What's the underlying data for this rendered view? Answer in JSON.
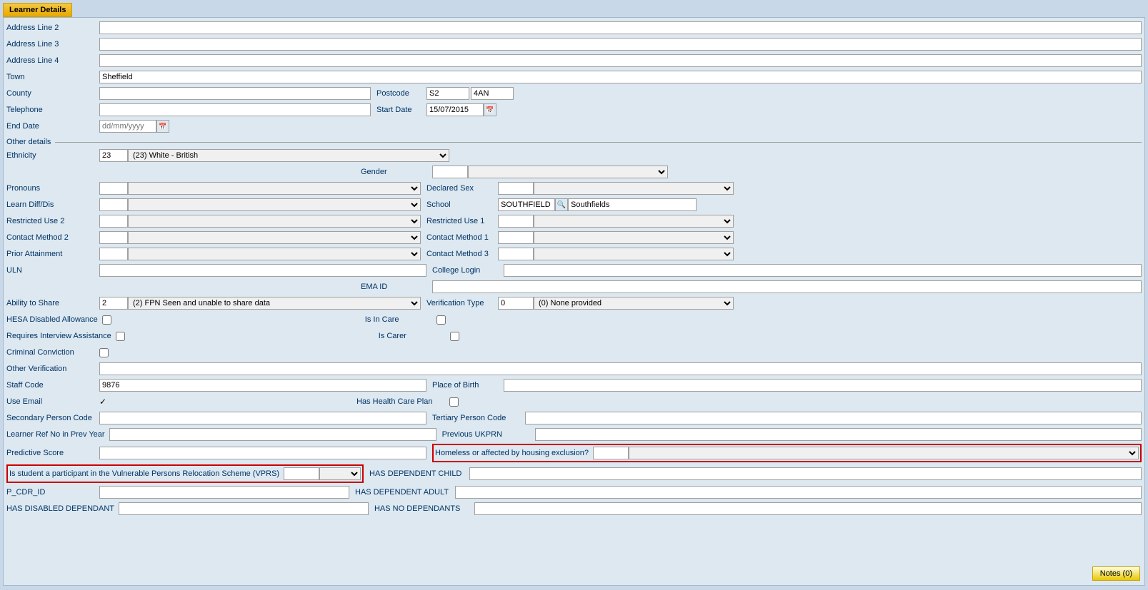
{
  "title": "Learner Details",
  "fields": {
    "address_line2": {
      "label": "Address Line 2",
      "value": ""
    },
    "address_line3": {
      "label": "Address Line 3",
      "value": ""
    },
    "address_line4": {
      "label": "Address Line 4",
      "value": ""
    },
    "town": {
      "label": "Town",
      "value": "Sheffield"
    },
    "county": {
      "label": "County",
      "value": ""
    },
    "postcode": {
      "label": "Postcode",
      "value1": "S2",
      "value2": "4AN"
    },
    "telephone": {
      "label": "Telephone",
      "value": ""
    },
    "start_date": {
      "label": "Start Date",
      "value": "15/07/2015"
    },
    "end_date": {
      "label": "End Date",
      "placeholder": "dd/mm/yyyy"
    },
    "other_details": "Other details",
    "ethnicity": {
      "label": "Ethnicity",
      "code": "23",
      "desc": "(23) White - British"
    },
    "gender": {
      "label": "Gender",
      "code": "",
      "desc": ""
    },
    "pronouns": {
      "label": "Pronouns",
      "code": "",
      "desc": ""
    },
    "declared_sex": {
      "label": "Declared Sex",
      "code": "",
      "desc": ""
    },
    "learn_diff_dis": {
      "label": "Learn Diff/Dis",
      "code": "",
      "desc": ""
    },
    "school": {
      "label": "School",
      "code": "SOUTHFIELD",
      "name": "Southfields"
    },
    "restricted_use2": {
      "label": "Restricted Use 2",
      "code": "",
      "desc": ""
    },
    "restricted_use1": {
      "label": "Restricted Use 1",
      "code": "",
      "desc": ""
    },
    "contact_method2": {
      "label": "Contact Method 2",
      "code": "",
      "desc": ""
    },
    "contact_method1": {
      "label": "Contact Method 1",
      "code": "",
      "desc": ""
    },
    "prior_attainment": {
      "label": "Prior Attainment",
      "code": "",
      "desc": ""
    },
    "contact_method3": {
      "label": "Contact Method 3",
      "code": "",
      "desc": ""
    },
    "uln": {
      "label": "ULN",
      "value": ""
    },
    "college_login": {
      "label": "College Login",
      "value": ""
    },
    "ema_id": {
      "label": "EMA ID",
      "value": ""
    },
    "ability_to_share": {
      "label": "Ability to Share",
      "code": "2",
      "desc": "(2) FPN Seen and unable to share data"
    },
    "verification_type": {
      "label": "Verification Type",
      "code": "0",
      "desc": "(0) None provided"
    },
    "hesa_disabled_allowance": {
      "label": "HESA Disabled Allowance",
      "checked": false
    },
    "is_in_care": {
      "label": "Is In Care",
      "checked": false
    },
    "requires_interview_assistance": {
      "label": "Requires Interview Assistance",
      "checked": false
    },
    "is_carer": {
      "label": "Is Carer",
      "checked": false
    },
    "criminal_conviction": {
      "label": "Criminal Conviction",
      "checked": false
    },
    "other_verification": {
      "label": "Other Verification",
      "value": ""
    },
    "staff_code": {
      "label": "Staff Code",
      "value": "9876"
    },
    "place_of_birth": {
      "label": "Place of Birth",
      "value": ""
    },
    "use_email": {
      "label": "Use Email",
      "checked": true
    },
    "has_health_care_plan": {
      "label": "Has Health Care Plan",
      "checked": false
    },
    "secondary_person_code": {
      "label": "Secondary Person Code",
      "value": ""
    },
    "tertiary_person_code": {
      "label": "Tertiary Person Code",
      "value": ""
    },
    "learner_ref_prev_year": {
      "label": "Learner Ref No in Prev Year",
      "value": ""
    },
    "previous_ukprn": {
      "label": "Previous UKPRN",
      "value": ""
    },
    "predictive_score": {
      "label": "Predictive Score",
      "value": ""
    },
    "homeless": {
      "label": "Homeless or affected by housing exclusion?",
      "code": "",
      "desc": ""
    },
    "vprs": {
      "label": "Is student a participant in the Vulnerable Persons Relocation Scheme (VPRS)",
      "code": "",
      "desc": ""
    },
    "has_dependent_child": {
      "label": "HAS DEPENDENT CHILD",
      "value": ""
    },
    "p_cdr_id": {
      "label": "P_CDR_ID",
      "value": ""
    },
    "has_dependent_adult": {
      "label": "HAS DEPENDENT ADULT",
      "value": ""
    },
    "has_disabled_dependant": {
      "label": "HAS DISABLED DEPENDANT",
      "value": ""
    },
    "has_no_dependants": {
      "label": "HAS NO DEPENDANTS",
      "value": ""
    },
    "notes_button": "Notes (0)"
  }
}
